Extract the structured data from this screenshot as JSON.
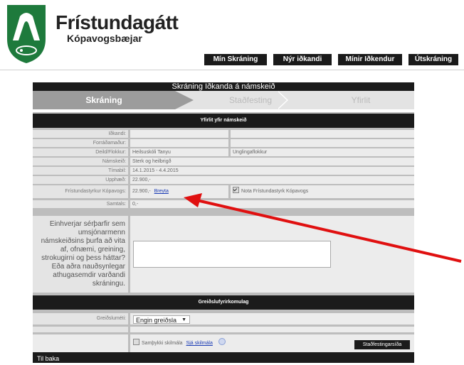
{
  "brand": {
    "title": "Frístundagátt",
    "subtitle": "Kópavogsbæjar",
    "logo_icon": "kopavogur-crest-icon",
    "accent_color": "#1e7a3c"
  },
  "nav": [
    "Mín Skráning",
    "Nýr iðkandi",
    "Mínir Iðkendur",
    "Útskráning"
  ],
  "page_title": "Skráning Iðkanda á námskeið",
  "steps": [
    {
      "label": "Skráning",
      "active": true
    },
    {
      "label": "Staðfesting",
      "active": false
    },
    {
      "label": "Yfirlit",
      "active": false
    }
  ],
  "overview": {
    "header": "Yfirlit yfir námskeið",
    "rows": [
      {
        "label": "Iðkandi:",
        "value": ""
      },
      {
        "label": "Forráðamaður:",
        "value": ""
      },
      {
        "label": "Deild/Flokkur:",
        "value": "Heilsuskóli Tanyu",
        "value2": "Unglingaflokkur"
      },
      {
        "label": "Námskeið:",
        "value": "Sterk og heilbrigð"
      },
      {
        "label": "Tímabil:",
        "value": "14.1.2015 - 4.4.2015"
      },
      {
        "label": "Upphæð:",
        "value": "22.900,-"
      },
      {
        "label": "Frístundastyrkur Kópavogs:",
        "value": "22.900,-",
        "link": "Breyta",
        "checkbox_label": "Nota Frístundastyrk Kópavogs"
      },
      {
        "label": "Samtals:",
        "value": "0,-"
      }
    ]
  },
  "notes_label": "Einhverjar sérþarfir sem umsjónarmenn námskeiðsins þurfa að vita af, ofnæmi, greining, strokugirni og þess háttar? Eða aðra nauðsynlegar athugasemdir varðandi skráningu.",
  "notes_value": "",
  "payment": {
    "header": "Greiðslufyrirkomulag",
    "label": "Greiðsluméti:",
    "selected": "Engin greiðsla"
  },
  "terms": {
    "checkbox_label": "Samþykki skilmála",
    "link": "Sjá skilmála"
  },
  "confirm_button": "Staðfestingarsíða",
  "back_link": "Til baka",
  "annotation_color": "#e01010"
}
